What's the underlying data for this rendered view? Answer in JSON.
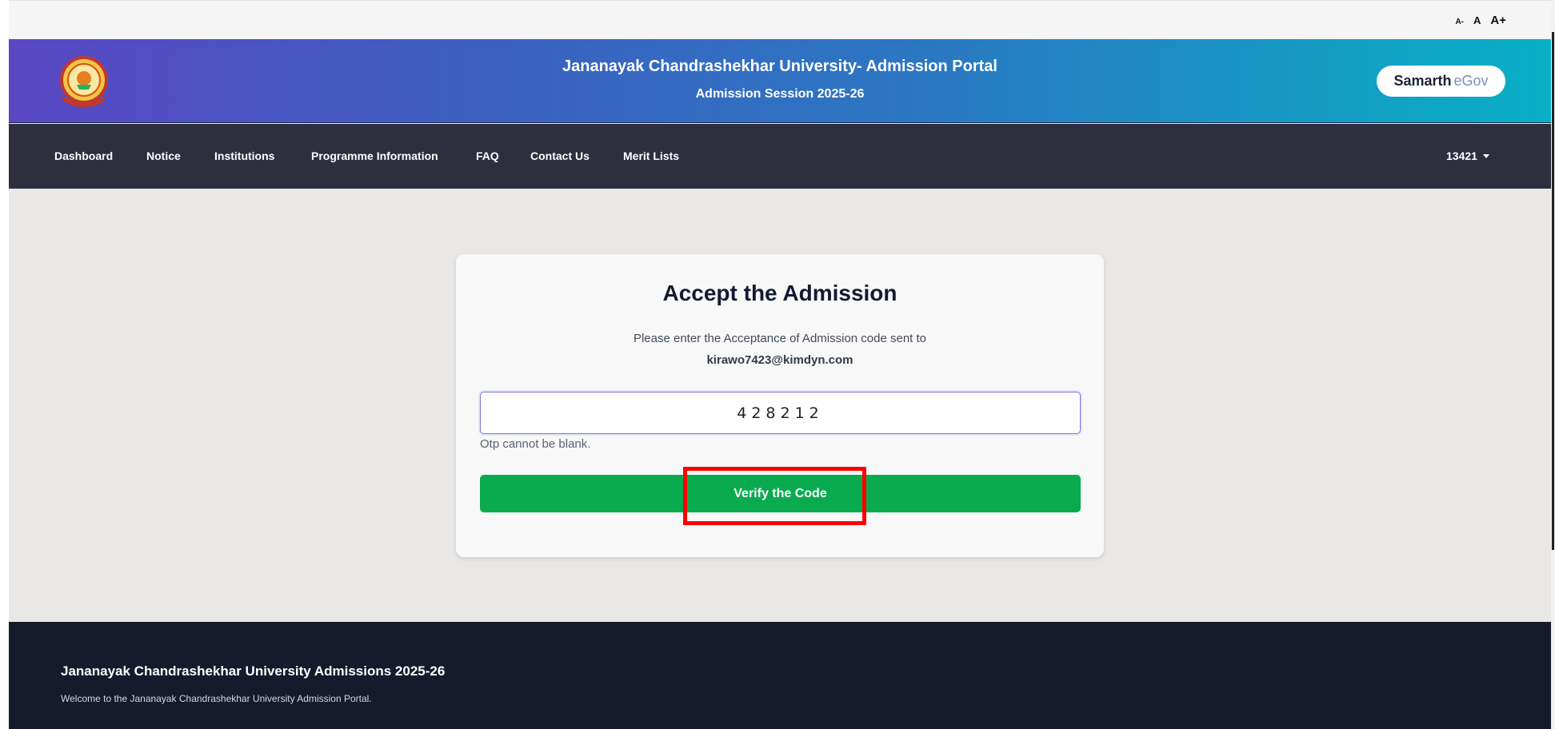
{
  "font_size_controls": {
    "small": "A-",
    "normal": "A",
    "large": "A+"
  },
  "header": {
    "title": "Jananayak Chandrashekhar University- Admission Portal",
    "subtitle": "Admission Session 2025-26",
    "logo_icon": "university-seal-icon",
    "brand": {
      "part1": "Samarth",
      "part2": "eGov"
    }
  },
  "nav": {
    "items": [
      {
        "label": "Dashboard"
      },
      {
        "label": "Notice"
      },
      {
        "label": "Institutions"
      },
      {
        "label": "Programme Information"
      },
      {
        "label": "FAQ"
      },
      {
        "label": "Contact Us"
      },
      {
        "label": "Merit Lists"
      }
    ],
    "user": "13421"
  },
  "card": {
    "title": "Accept the Admission",
    "message": "Please enter the Acceptance of Admission code sent to",
    "email": "kirawo7423@kimdyn.com",
    "otp_value": "428212",
    "error": "Otp cannot be blank.",
    "button_label": "Verify the Code"
  },
  "footer": {
    "title": "Jananayak Chandrashekhar University Admissions 2025-26",
    "text": "Welcome to the Jananayak Chandrashekhar University Admission Portal."
  },
  "colors": {
    "header_gradient_start": "#5b47c4",
    "header_gradient_end": "#08b0c6",
    "nav_bg": "#2e2f3e",
    "button_green": "#0aab4f",
    "highlight_red": "#ff0000",
    "footer_bg": "#151a2d"
  }
}
